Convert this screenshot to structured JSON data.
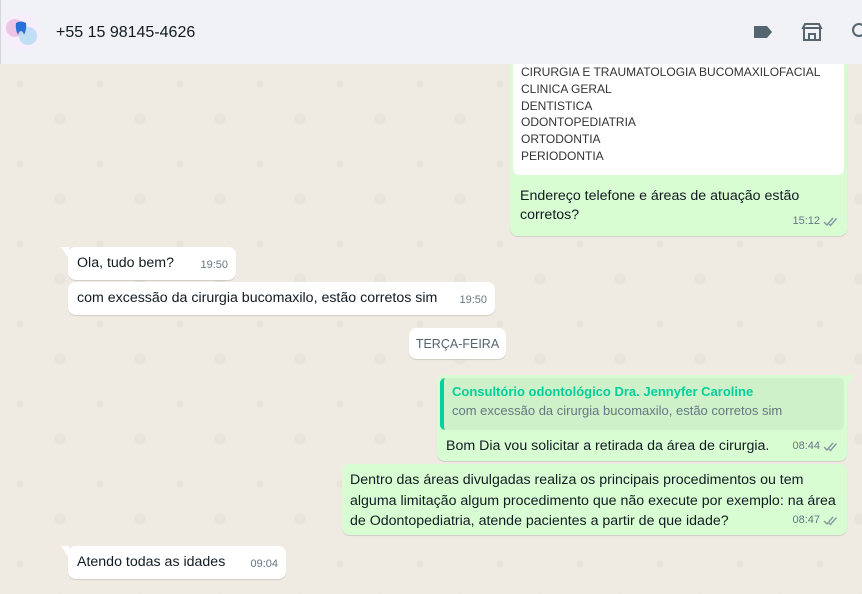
{
  "header": {
    "contact_name": "+55 15 98145-4626",
    "icons": [
      "label-icon",
      "catalog-icon",
      "search-icon"
    ]
  },
  "messages": {
    "m0": {
      "direction": "out",
      "image_lines": [
        "CIRURGIA E TRAUMATOLOGIA BUCOMAXILOFACIAL",
        "CLINICA GERAL",
        "DENTISTICA",
        "ODONTOPEDIATRIA",
        "ORTODONTIA",
        "PERIODONTIA"
      ],
      "text": "Endereço telefone e áreas de atuação estão corretos?",
      "time": "15:12",
      "status": "read"
    },
    "m1": {
      "direction": "in",
      "text": "Ola, tudo bem?",
      "time": "19:50"
    },
    "m2": {
      "direction": "in",
      "text": "com excessão da cirurgia bucomaxilo, estão corretos sim",
      "time": "19:50"
    },
    "day_divider": "TERÇA-FEIRA",
    "m3": {
      "direction": "out",
      "quote_author": "Consultório odontológico Dra. Jennyfer Caroline",
      "quote_text": "com excessão da cirurgia bucomaxilo, estão corretos sim",
      "text": "Bom Dia vou solicitar a retirada da área de cirurgia.",
      "time": "08:44",
      "status": "read"
    },
    "m4": {
      "direction": "out",
      "text": "Dentro das áreas divulgadas realiza os principais procedimentos ou tem alguma limitação algum procedimento que não execute por exemplo:  na área de Odontopediatria, atende pacientes a partir de que idade?",
      "time": "08:47",
      "status": "read"
    },
    "m5": {
      "direction": "in",
      "text": "Atendo todas as idades",
      "time": "09:04"
    }
  },
  "colors": {
    "outgoing_bubble": "#d9fdd3",
    "incoming_bubble": "#ffffff",
    "chat_background": "#efeae2",
    "quote_accent": "#06cf9c",
    "read_ticks": "#8696a0"
  }
}
